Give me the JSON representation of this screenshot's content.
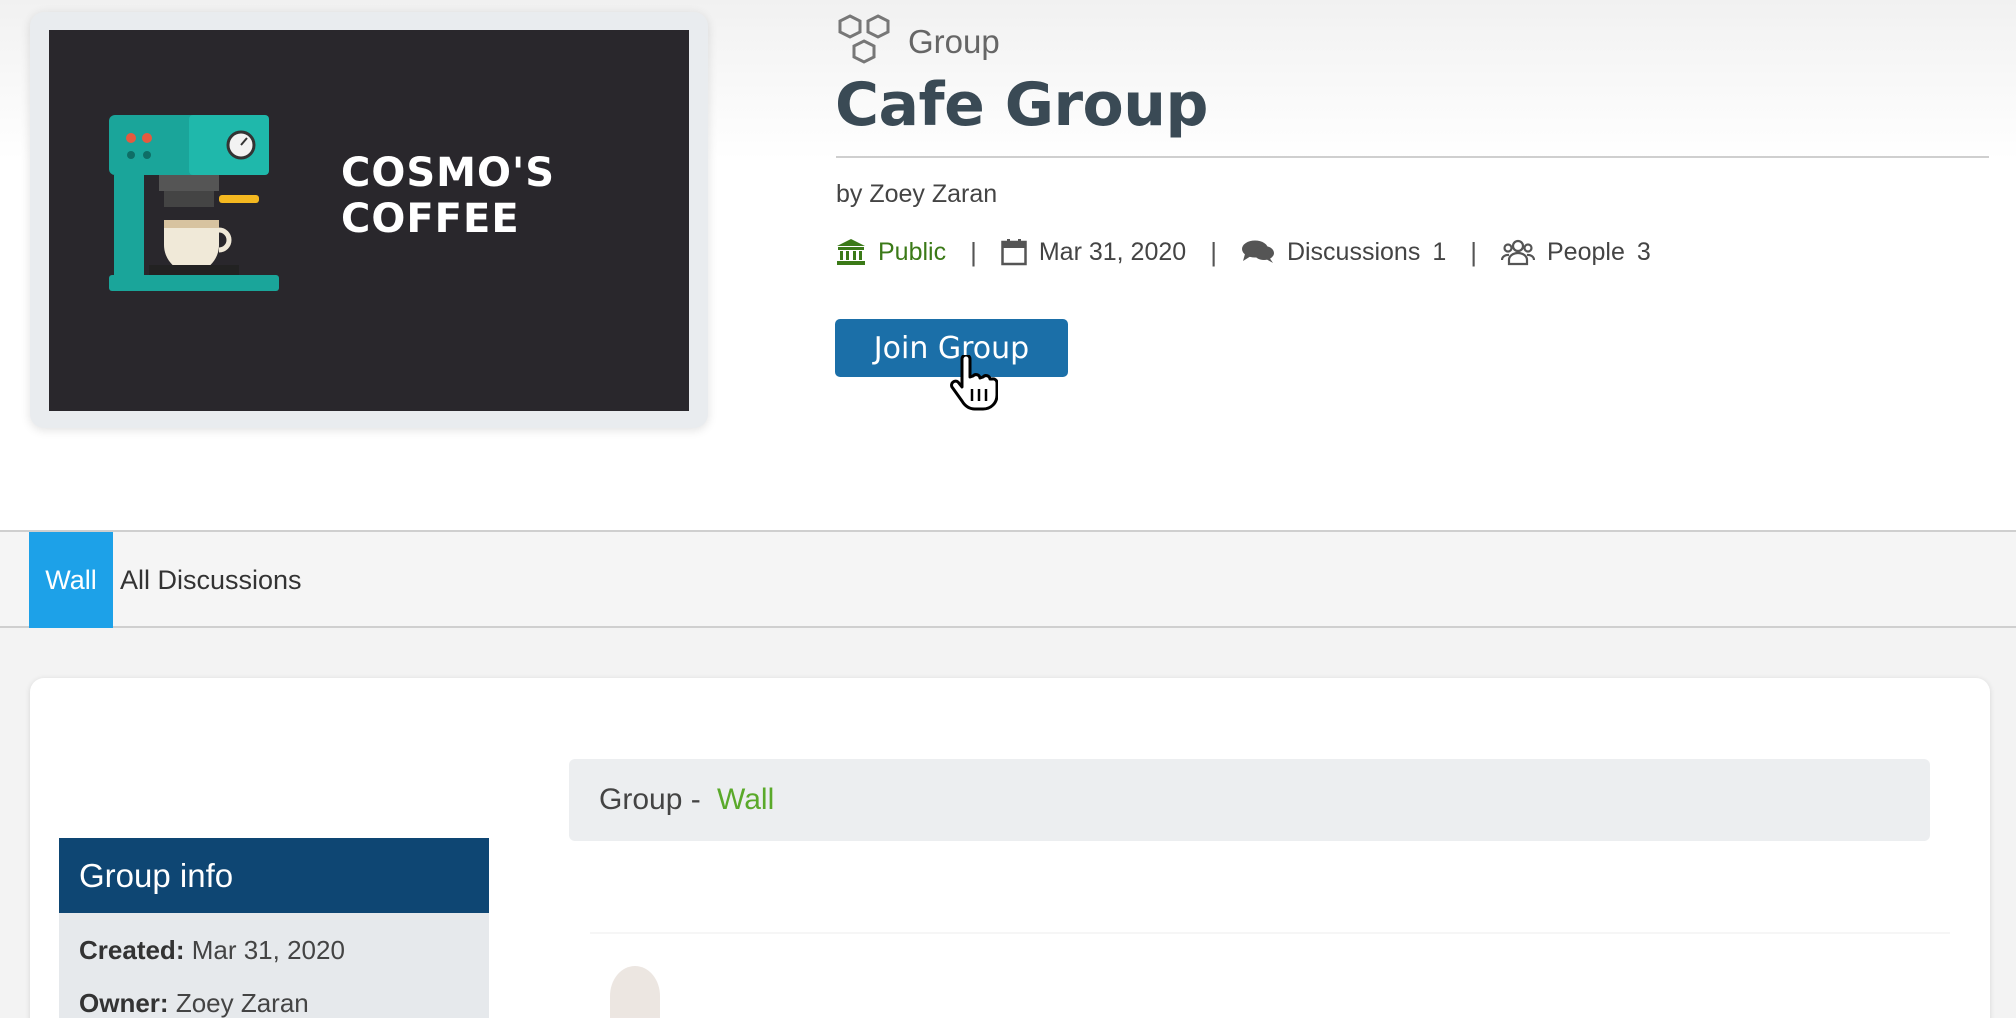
{
  "header": {
    "logo_line1": "COSMO'S",
    "logo_line2": "COFFEE",
    "kicker": "Group",
    "title": "Cafe Group",
    "byline": "by Zoey Zaran",
    "meta": {
      "visibility": "Public",
      "date": "Mar 31, 2020",
      "discussions_label": "Discussions",
      "discussions_count": "1",
      "people_label": "People",
      "people_count": "3",
      "separator": "|"
    },
    "join_label": "Join Group"
  },
  "tabs": [
    {
      "label": "Wall",
      "active": true
    },
    {
      "label": "All Discussions",
      "active": false
    }
  ],
  "group_info": {
    "heading": "Group info",
    "created_label": "Created:",
    "created_value": "Mar 31, 2020",
    "owner_label": "Owner:",
    "owner_value": "Zoey Zaran"
  },
  "wall": {
    "heading_prefix": "Group - ",
    "heading_highlight": "Wall"
  },
  "colors": {
    "primary_button": "#1b6fa8",
    "active_tab": "#1da1e8",
    "info_header": "#0e4673",
    "public_green": "#3b7a18",
    "wall_green": "#5aa92a"
  },
  "icons": {
    "kicker": "hexagon-cluster-icon",
    "visibility": "bank-icon",
    "date": "calendar-icon",
    "discussions": "chat-bubbles-icon",
    "people": "people-icon",
    "cursor": "hand-pointer-icon"
  }
}
